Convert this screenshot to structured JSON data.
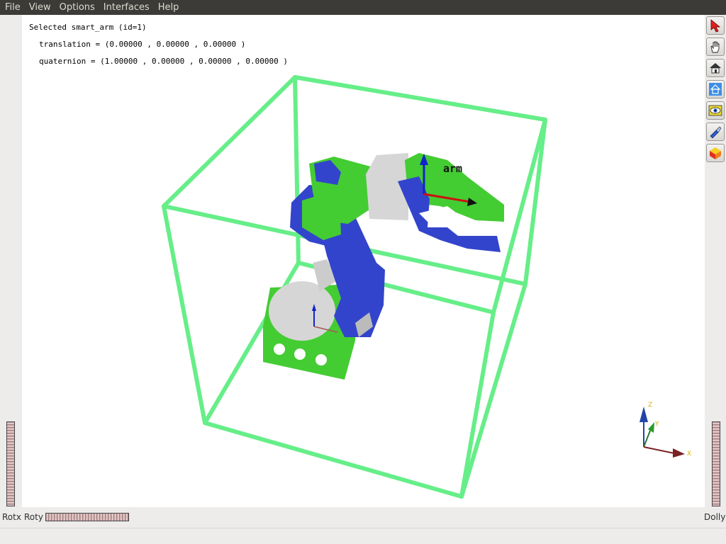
{
  "menubar": {
    "items": [
      {
        "label": "File"
      },
      {
        "label": "View"
      },
      {
        "label": "Options"
      },
      {
        "label": "Interfaces"
      },
      {
        "label": "Help"
      }
    ]
  },
  "info": {
    "selected": "Selected smart_arm (id=1)",
    "translation": "translation = (0.00000 , 0.00000 , 0.00000 )",
    "quaternion": "quaternion = (1.00000 , 0.00000 , 0.00000 , 0.00000 )"
  },
  "scene": {
    "arm_label": "arm",
    "axis_z": "Z",
    "axis_y": "Y",
    "axis_x": "X",
    "colors": {
      "bbox": "#66ee88",
      "green_parts": "#44cc33",
      "blue_parts": "#3344cc",
      "gray_parts": "#d6d6d6"
    }
  },
  "toolbar": {
    "tools": [
      {
        "icon": "pick-arrow-icon"
      },
      {
        "icon": "hand-view-icon"
      },
      {
        "icon": "home-icon"
      },
      {
        "icon": "set-home-icon"
      },
      {
        "icon": "view-all-eye-icon"
      },
      {
        "icon": "seek-flashlight-icon"
      },
      {
        "icon": "projection-cube-icon"
      }
    ]
  },
  "wheels": {
    "rotx_label": "Rotx",
    "roty_label": "Roty",
    "dolly_label": "Dolly"
  }
}
